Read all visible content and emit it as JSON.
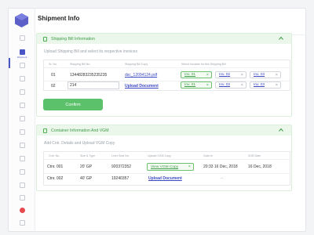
{
  "colors": {
    "accent": "#4a56c6",
    "success": "#5bc16a",
    "link": "#3b49c4",
    "alert": "#e5484d"
  },
  "sidebar": {
    "items": [
      {
        "icon": "home-icon",
        "label": ""
      },
      {
        "icon": "shipment-icon",
        "label": "Shipment",
        "active": true
      },
      {
        "icon": "dollar-icon",
        "label": ""
      },
      {
        "icon": "doc-icon",
        "label": ""
      },
      {
        "icon": "truck-icon",
        "label": ""
      },
      {
        "icon": "box-icon",
        "label": ""
      },
      {
        "icon": "chart-icon",
        "label": ""
      },
      {
        "icon": "code-icon",
        "label": ""
      },
      {
        "icon": "user-icon",
        "label": ""
      },
      {
        "icon": "settings-icon",
        "label": ""
      },
      {
        "icon": "globe-icon",
        "label": ""
      },
      {
        "icon": "list-icon",
        "label": ""
      },
      {
        "icon": "help-icon",
        "label": ""
      },
      {
        "icon": "notification-icon",
        "label": ""
      },
      {
        "icon": "logout-icon",
        "label": ""
      }
    ]
  },
  "page": {
    "title": "Shipment Info"
  },
  "shipping": {
    "title": "Shipping Bill Information",
    "subtitle": "Upload Shipping Bill and select its respective invoices",
    "headers": [
      "Sr. No.",
      "Shipping Bill No.",
      "Shipping Bill Copy",
      "Select invoices for this Shipping Bill"
    ],
    "rows": [
      {
        "sr": "01",
        "bill_no": "13448283235235235",
        "copy": "dsc_12094124.pdf",
        "invoices": [
          {
            "label": "Inv. 01",
            "selected": true
          },
          {
            "label": "Inv. 02",
            "selected": false
          },
          {
            "label": "Inv. 03",
            "selected": false
          }
        ]
      },
      {
        "sr": "02",
        "bill_no": "214",
        "copy": "Upload Document",
        "invoices": [
          {
            "label": "Inv. 01",
            "selected": true
          },
          {
            "label": "Inv. 02",
            "selected": false
          },
          {
            "label": "Inv. 03",
            "selected": false
          }
        ]
      }
    ],
    "confirm_label": "Confirm"
  },
  "container": {
    "title": "Container Information And VGM",
    "subtitle": "Add Cntr. Details and Upload VGM Copy",
    "headers": [
      "Cntr. No.",
      "Size & Type",
      "Liner Seal No.",
      "Upload VGM Copy",
      "Gate-In",
      "SOB Date"
    ],
    "rows": [
      {
        "cntr": "Ctnr. 001",
        "size": "20' GP",
        "seal": "920372352",
        "vgm": "View VGM Copy",
        "vgm_selected": true,
        "gate_in": "20:33  16 Dec, 2018",
        "sob": "16 Dec, 2018"
      },
      {
        "cntr": "Ctnr. 002",
        "size": "40' GP",
        "seal": "19240357",
        "vgm": "Upload Document",
        "vgm_selected": false,
        "gate_in": "--",
        "sob": ""
      }
    ]
  }
}
